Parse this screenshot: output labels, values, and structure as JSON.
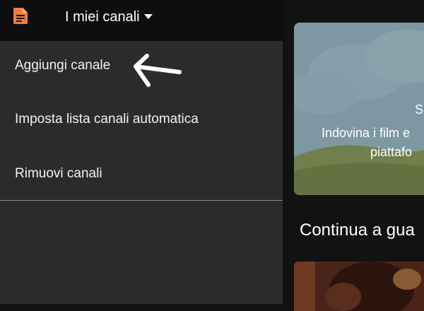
{
  "header": {
    "app_icon": "document-icon",
    "channel_selector_label": "I miei canali",
    "caret_icon": "caret-down-icon",
    "accent_color": "#f07f3c"
  },
  "menu": {
    "items": [
      {
        "label": "Aggiungi canale"
      },
      {
        "label": "Imposta lista canali automatica"
      },
      {
        "label": "Rimuovi canali"
      }
    ],
    "annotation_icon": "arrow-left-icon"
  },
  "content": {
    "hero": {
      "line1": "S",
      "line2": "Indovina i film e",
      "line3": "piattafo"
    },
    "section_title": "Continua a gua"
  }
}
